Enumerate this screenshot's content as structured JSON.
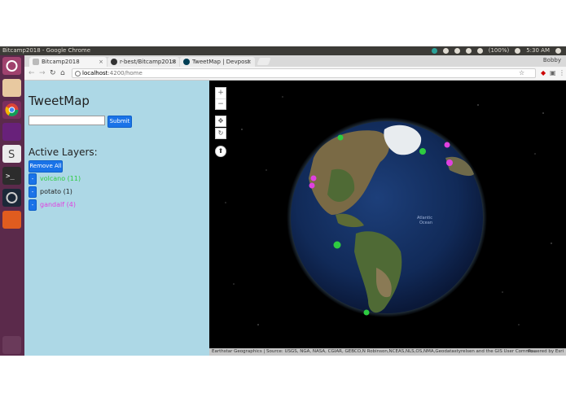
{
  "os_panel": {
    "window_title": "Bitcamp2018 - Google Chrome",
    "battery": "(100%)",
    "clock": "5:30 AM"
  },
  "browser": {
    "profile": "Bobby",
    "tabs": [
      {
        "label": "Bitcamp2018",
        "active": true
      },
      {
        "label": "r-best/Bitcamp2018",
        "active": false
      },
      {
        "label": "TweetMap | Devpost",
        "active": false
      }
    ],
    "url_host": "localhost",
    "url_path": ":4200/home"
  },
  "app": {
    "title": "TweetMap",
    "search_value": "",
    "submit_label": "Submit",
    "layers_heading": "Active Layers:",
    "remove_all_label": "Remove All",
    "remove_layer_label": "-",
    "layers": [
      {
        "label": "volcano (11)",
        "color": "#2ecc40"
      },
      {
        "label": "potato (1)",
        "color": "#222222"
      },
      {
        "label": "gandalf (4)",
        "color": "#e040e0"
      }
    ]
  },
  "map": {
    "zoom_in": "+",
    "zoom_out": "−",
    "pan": "✥",
    "rotate": "↻",
    "compass": "⬆",
    "attribution": "Earthstar Geographics | Source: USGS, NGA, NASA, CGIAR, GEBCO,N Robinson,NCEAS,NLS,OS,NMA,Geodatastyrelsen and the GIS User Commu...",
    "powered_by": "Powered by Esri",
    "ocean_label_1": "Atlantic",
    "ocean_label_2": "Ocean",
    "colors": {
      "volcano": "#2ecc40",
      "gandalf": "#e040e0"
    }
  }
}
